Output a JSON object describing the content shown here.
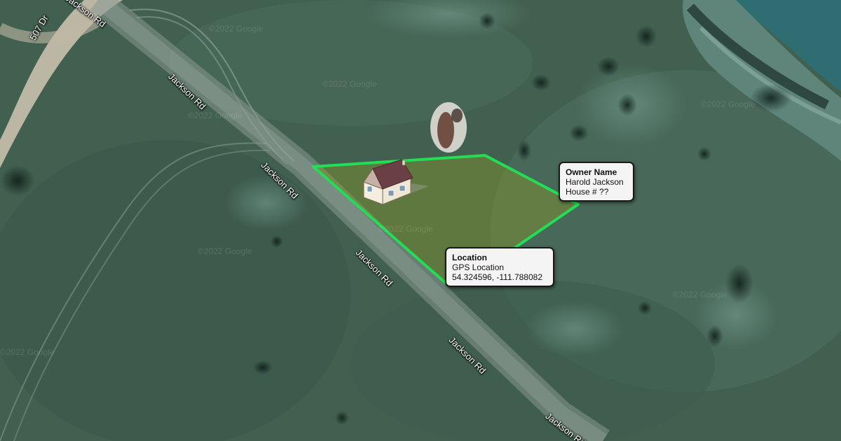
{
  "roads": {
    "top_left": "Jackson Rd",
    "upper": "Jackson Rd",
    "middle": "Jackson Rd",
    "lower": "Jackson Rd",
    "bottom": "Jackson Rd",
    "edge": "Jackson Rd",
    "side_road": "507 Dr"
  },
  "watermark": "©2022 Google",
  "owner_card": {
    "title": "Owner Name",
    "line1": "Harold Jackson",
    "line2": "House # ??"
  },
  "location_card": {
    "title": "Location",
    "line1": "GPS Location",
    "line2": "54.324596, -111.788082"
  },
  "parcel": {
    "outline_color": "#22dd55",
    "fill_color": "#8a9a2a"
  },
  "icons": {
    "house": "house-icon"
  }
}
